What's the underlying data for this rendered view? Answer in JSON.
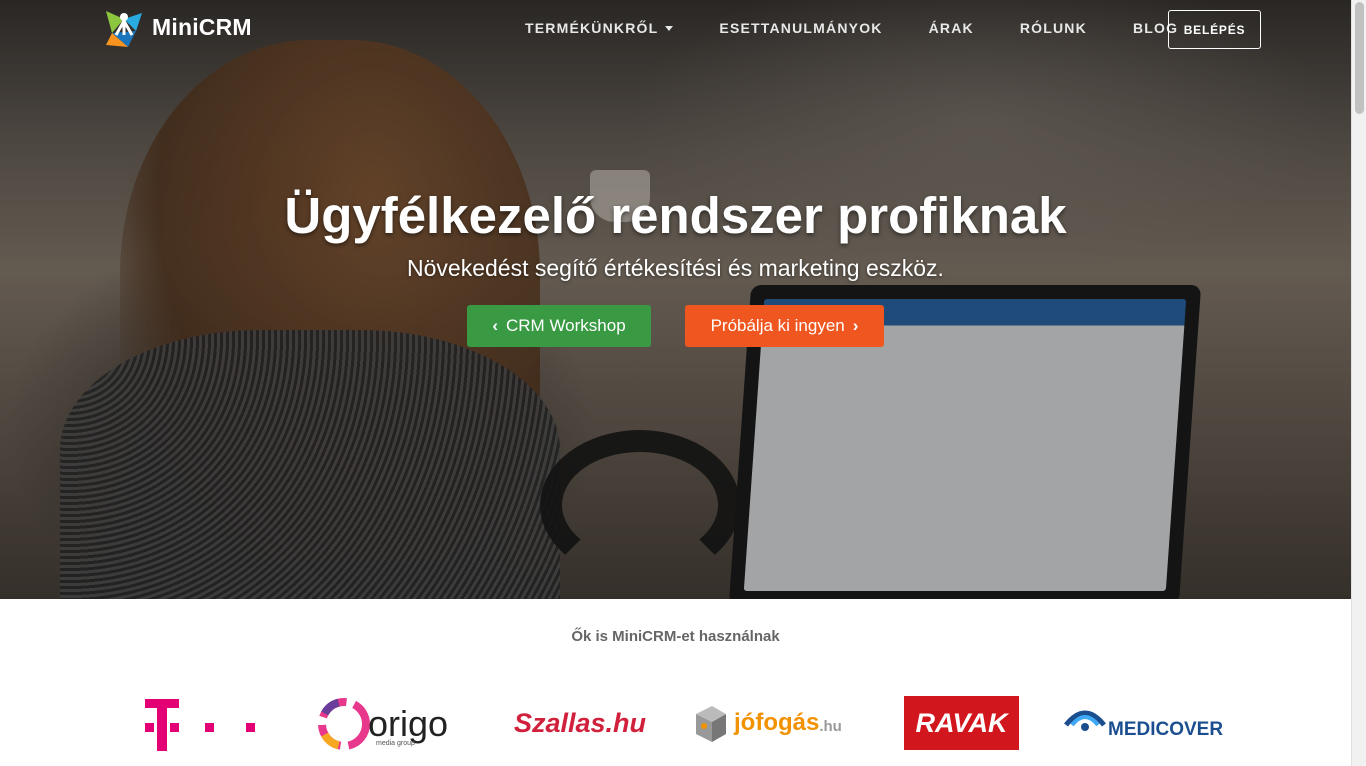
{
  "brand": {
    "name": "MiniCRM"
  },
  "nav": {
    "items": [
      {
        "label": "TERMÉKÜNKRŐL",
        "has_dropdown": true
      },
      {
        "label": "ESETTANULMÁNYOK",
        "has_dropdown": false
      },
      {
        "label": "ÁRAK",
        "has_dropdown": false
      },
      {
        "label": "RÓLUNK",
        "has_dropdown": false
      },
      {
        "label": "BLOG",
        "has_dropdown": false
      }
    ],
    "login_label": "BELÉPÉS"
  },
  "hero": {
    "title": "Ügyfélkezelő rendszer profiknak",
    "subtitle": "Növekedést segítő értékesítési és marketing eszköz.",
    "primary_button": {
      "label": "CRM Workshop",
      "icon": "chevron-left-icon",
      "color": "#3a9a44"
    },
    "secondary_button": {
      "label": "Próbálja ki ingyen",
      "icon": "chevron-right-icon",
      "color": "#f0561f"
    }
  },
  "clients": {
    "title": "Ők is MiniCRM-et használnak",
    "logos": [
      {
        "name": "telekom-logo",
        "text": "T · ·",
        "color": "#e20074"
      },
      {
        "name": "origo-logo",
        "text": "origo",
        "subtext": "media group",
        "color": "#222222"
      },
      {
        "name": "szallas-logo",
        "text": "Szallas.hu",
        "color": "#d0203c"
      },
      {
        "name": "jofogas-logo",
        "text": "jófogás",
        "suffix": ".hu",
        "color": "#f39200"
      },
      {
        "name": "ravak-logo",
        "text": "RAVAK",
        "color": "#d2161d"
      },
      {
        "name": "medicover-logo",
        "text": "MEDICOVER",
        "color": "#1a4e8f"
      }
    ]
  }
}
